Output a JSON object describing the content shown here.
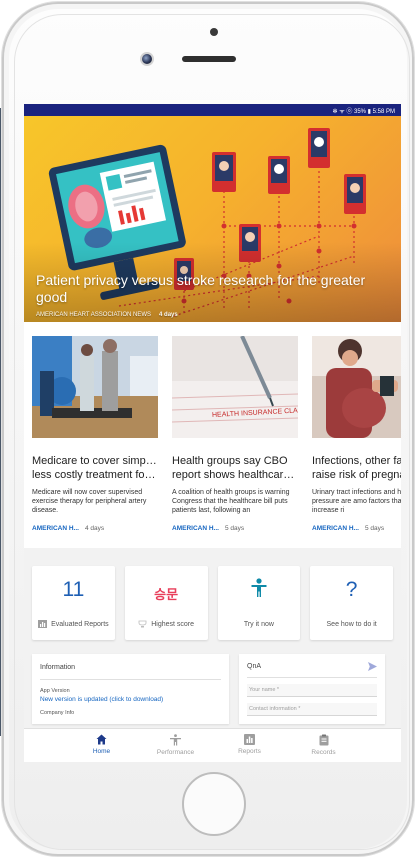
{
  "status_bar": {
    "text": "✻ ᯤ ⓞ 35% ▮ 5:58 PM"
  },
  "hero": {
    "title": "Patient privacy versus stroke research for the greater good",
    "source": "AMERICAN HEART ASSOCIATION NEWS",
    "days": "4 days"
  },
  "articles": [
    {
      "title_line1": "Medicare to cover simpler,",
      "title_line2": "less costly treatment for ...",
      "description": "Medicare will now cover supervised exercise therapy for peripheral artery disease.",
      "source": "AMERICAN H...",
      "days": "4 days"
    },
    {
      "title_line1": "Health groups say CBO",
      "title_line2": "report shows healthcare ...",
      "description": "A coalition of health groups is warning Congress that the healthcare bill puts patients last, following an",
      "source": "AMERICAN H...",
      "days": "5 days"
    },
    {
      "title_line1": "Infections, other fac",
      "title_line2": "raise risk of pregnar",
      "description": "Urinary tract infections and high blood pressure are amo factors that may increase ri",
      "source": "AMERICAN H...",
      "days": "5 days"
    }
  ],
  "stats": {
    "evaluated": {
      "value": "11",
      "label": "Evaluated Reports",
      "icon": "report-icon"
    },
    "highest": {
      "value": "승문",
      "label": "Highest score",
      "icon": "trophy-icon"
    },
    "try": {
      "label": "Try it now",
      "icon": "person-icon"
    },
    "how": {
      "value": "?",
      "label": "See how to do it",
      "icon": "question-icon"
    }
  },
  "info_panel": {
    "title": "Information",
    "app_version_label": "App Version",
    "app_version_link": "New version is updated (click to download)",
    "company_info_label": "Company Info"
  },
  "qna_panel": {
    "title": "QnA",
    "name_placeholder": "Your name *",
    "contact_placeholder": "Contact information *"
  },
  "bottom_nav": [
    {
      "label": "Home",
      "icon": "home-icon",
      "active": true
    },
    {
      "label": "Performance",
      "icon": "figure-icon",
      "active": false
    },
    {
      "label": "Reports",
      "icon": "bar-chart-icon",
      "active": false
    },
    {
      "label": "Records",
      "icon": "clipboard-icon",
      "active": false
    }
  ],
  "colors": {
    "status_bar": "#1a237e",
    "accent_blue": "#1e5fb4",
    "link_blue": "#1565c0",
    "korean_pink": "#e83e5a",
    "hero_yellow": "#f7c62a"
  }
}
